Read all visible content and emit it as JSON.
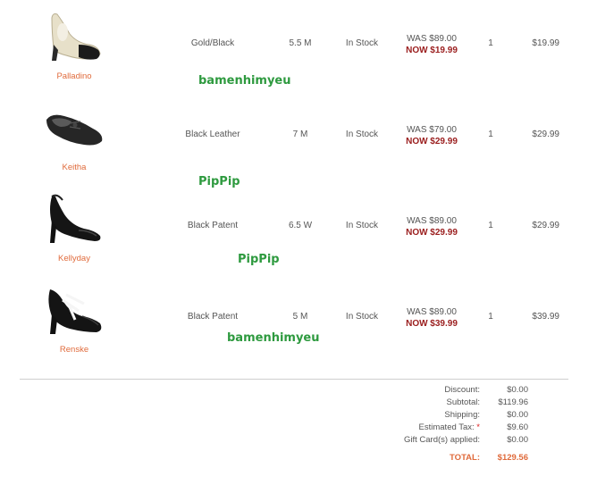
{
  "items": [
    {
      "name": "Palladino",
      "color": "Gold/Black",
      "size": "5.5 M",
      "stock": "In Stock",
      "was": "WAS  $89.00",
      "now": "NOW $19.99",
      "qty": "1",
      "total": "$19.99"
    },
    {
      "name": "Keitha",
      "color": "Black Leather",
      "size": "7 M",
      "stock": "In Stock",
      "was": "WAS  $79.00",
      "now": "NOW $29.99",
      "qty": "1",
      "total": "$29.99"
    },
    {
      "name": "Kellyday",
      "color": "Black Patent",
      "size": "6.5 W",
      "stock": "In Stock",
      "was": "WAS  $89.00",
      "now": "NOW $29.99",
      "qty": "1",
      "total": "$29.99"
    },
    {
      "name": "Renske",
      "color": "Black Patent",
      "size": "5 M",
      "stock": "In Stock",
      "was": "WAS  $89.00",
      "now": "NOW $39.99",
      "qty": "1",
      "total": "$39.99"
    }
  ],
  "watermarks": [
    "bamenhimyeu",
    "PipPip",
    "PipPip",
    "bamenhimyeu"
  ],
  "summary": {
    "discount_label": "Discount:",
    "discount": "$0.00",
    "subtotal_label": "Subtotal:",
    "subtotal": "$119.96",
    "shipping_label": "Shipping:",
    "shipping": "$0.00",
    "tax_label": "Estimated Tax:",
    "tax_mark": "*",
    "tax": "$9.60",
    "gift_label": "Gift Card(s) applied:",
    "gift": "$0.00",
    "total_label": "TOTAL:",
    "total": "$129.56"
  },
  "icons": [
    "pump-shoe-icon",
    "flat-shoe-icon",
    "slingback-shoe-icon",
    "strappy-sandal-icon"
  ]
}
